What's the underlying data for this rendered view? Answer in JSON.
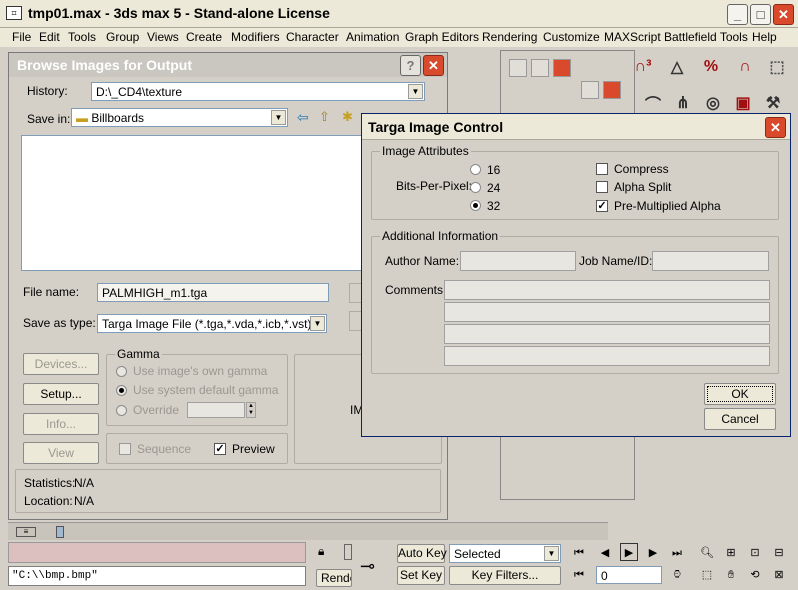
{
  "app": {
    "title": "tmp01.max - 3ds max 5 - Stand-alone License",
    "icon_label": "⌗",
    "minimize_label": "_",
    "maximize_label": "□",
    "close_label": "✕"
  },
  "menu": [
    "File",
    "Edit",
    "Tools",
    "Group",
    "Views",
    "Create",
    "Modifiers",
    "Character",
    "Animation",
    "Graph Editors",
    "Rendering",
    "Customize",
    "MAXScript",
    "Battlefield Tools",
    "Help"
  ],
  "browse": {
    "title": "Browse Images for Output",
    "help_label": "?",
    "close_label": "✕",
    "history_label": "History:",
    "history_value": "D:\\_CD4\\texture",
    "savein_label": "Save in:",
    "savein_value": "Billboards",
    "filename_label": "File name:",
    "filename_value": "PALMHIGH_m1.tga",
    "saveastype_label": "Save as type:",
    "saveastype_value": "Targa Image File (*.tga,*.vda,*.icb,*.vst)",
    "devices_label": "Devices...",
    "setup_label": "Setup...",
    "info_label": "Info...",
    "view_label": "View",
    "gamma_label": "Gamma",
    "gamma_own": "Use image's own gamma",
    "gamma_system": "Use system default gamma",
    "gamma_override": "Override",
    "sequence_label": "Sequence",
    "preview_label": "Preview",
    "statistics_label": "Statistics:",
    "statistics_value": "N/A",
    "location_label": "Location:",
    "location_value": "N/A",
    "partial_label": "IM"
  },
  "targa": {
    "title": "Targa Image Control",
    "close_label": "✕",
    "image_attributes_label": "Image Attributes",
    "bpp_label": "Bits-Per-Pixel:",
    "bpp_options": [
      "16",
      "24",
      "32"
    ],
    "bpp_selected": "32",
    "compress_label": "Compress",
    "compress_checked": false,
    "alpha_split_label": "Alpha Split",
    "alpha_split_checked": false,
    "premult_label": "Pre-Multiplied Alpha",
    "premult_checked": true,
    "additional_info_label": "Additional Information",
    "author_label": "Author Name:",
    "author_value": "",
    "job_label": "Job Name/ID:",
    "job_value": "",
    "comments_label": "Comments:",
    "ok_label": "OK",
    "cancel_label": "Cancel"
  },
  "bottom": {
    "script_value": "\"C:\\\\bmp.bmp\"",
    "render_label": "Rende",
    "autokey_label": "Auto Key",
    "setkey_label": "Set Key",
    "selected_value": "Selected",
    "keyfilters_label": "Key Filters...",
    "frame_value": "0"
  },
  "colors": {
    "accent_close": "#d94a2c",
    "dialog_border": "#0a246a",
    "script_listener": "#dcc0c0"
  }
}
